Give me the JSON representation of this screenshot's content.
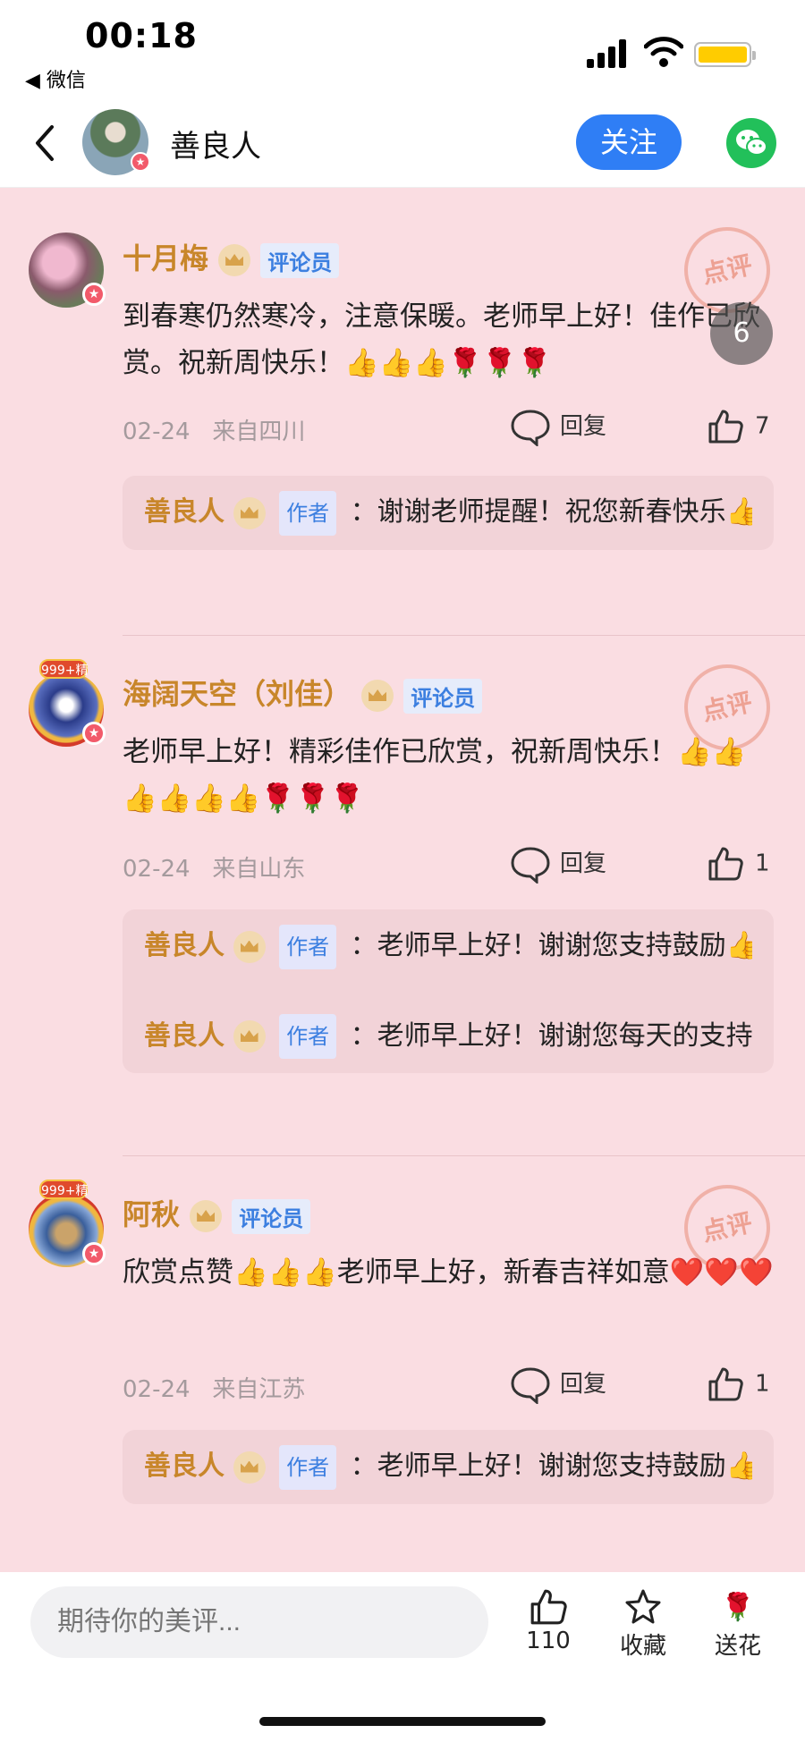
{
  "status_bar": {
    "time": "00:18",
    "back_app": "◀ 微信"
  },
  "header": {
    "name": "善良人",
    "follow_label": "关注"
  },
  "stamp_label": "点评",
  "float_button_label": "6",
  "comments": [
    {
      "name": "十月梅",
      "role": "评论员",
      "text": "到春寒仍然寒冷，注意保暖。老师早上好！佳作已欣赏。祝新周快乐！👍👍👍🌹🌹🌹",
      "date": "02-24",
      "location": "来自四川",
      "reply_label": "回复",
      "likes": "7",
      "replies": [
        {
          "name": "善良人",
          "role": "作者",
          "text": "：谢谢老师提醒！祝您新春快乐👍👍👍👍👍👍🌹🌹🌹🌹..."
        }
      ]
    },
    {
      "name": "海阔天空（刘佳）",
      "role": "评论员",
      "avatar_badge": "999+精",
      "text": "老师早上好！精彩佳作已欣赏，祝新周快乐！👍👍👍👍👍👍🌹🌹🌹",
      "date": "02-24",
      "location": "来自山东",
      "reply_label": "回复",
      "likes": "1",
      "replies": [
        {
          "name": "善良人",
          "role": "作者",
          "text": "：老师早上好！谢谢您支持鼓励👍👍👍👍👍👍🌹🌹🌹🌹..."
        },
        {
          "name": "善良人",
          "role": "作者",
          "text": "：老师早上好！谢谢您每天的支持鼓励👍👍👍👍👍👍🌹🌹..."
        }
      ]
    },
    {
      "name": "阿秋",
      "role": "评论员",
      "avatar_badge": "999+精",
      "text": "欣赏点赞👍👍👍老师早上好，新春吉祥如意❤️❤️❤️",
      "date": "02-24",
      "location": "来自江苏",
      "reply_label": "回复",
      "likes": "1",
      "replies": [
        {
          "name": "善良人",
          "role": "作者",
          "text": "：老师早上好！谢谢您支持鼓励👍👍👍👍👍👍🌹🌹🌹🌹..."
        }
      ]
    }
  ],
  "bottom_bar": {
    "placeholder": "期待你的美评...",
    "like_count": "110",
    "collect_label": "收藏",
    "flower_label": "送花"
  },
  "colors": {
    "accent": "#2f7ef5",
    "background": "#fadde2",
    "username": "#c8862a",
    "wechat": "#22c05a"
  }
}
